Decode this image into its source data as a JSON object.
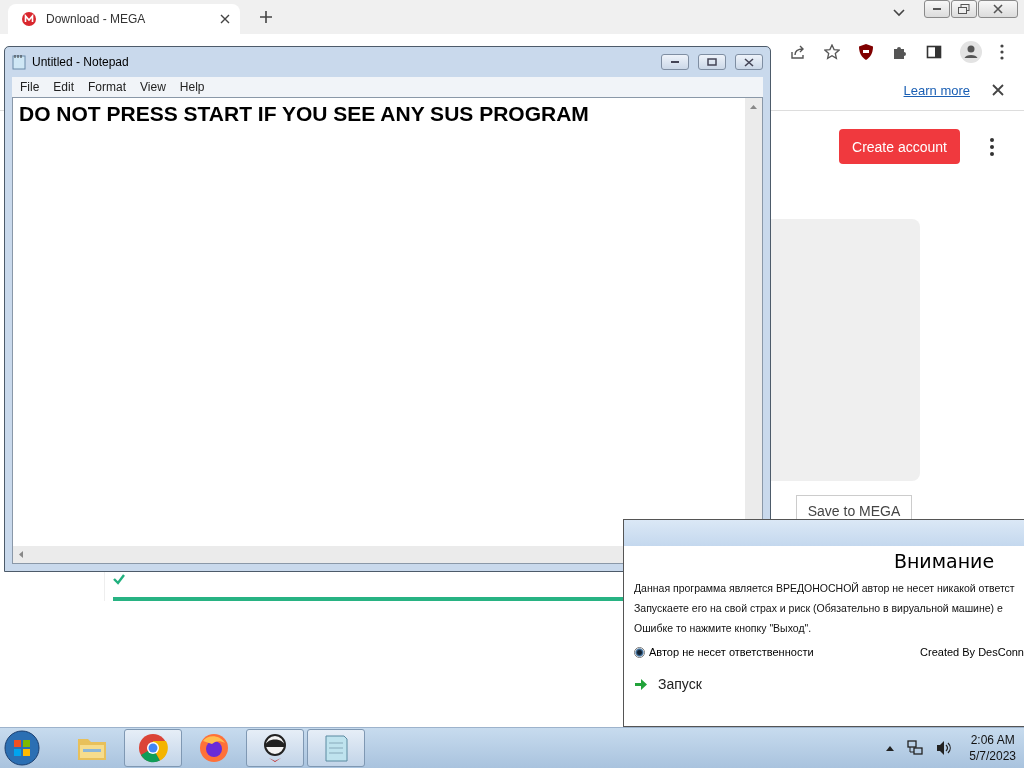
{
  "browser": {
    "tab": {
      "title": "Download - MEGA"
    },
    "info_bar": {
      "link": "Learn more"
    },
    "page": {
      "create_account": "Create account",
      "save_button": "Save to MEGA",
      "progress": {
        "level": 1
      }
    }
  },
  "notepad": {
    "title": "Untitled - Notepad",
    "menu": [
      "File",
      "Edit",
      "Format",
      "View",
      "Help"
    ],
    "content": "DO NOT PRESS START IF YOU SEE ANY SUS PROGRAM"
  },
  "dialog": {
    "heading": "Внимание",
    "lines": [
      "Данная программа является ВРЕДОНОСНОЙ автор не несет никакой ответст",
      "Запускаете его на свой страх и риск (Обязательно в вируальной машине) е",
      "Ошибке то нажмите кнопку \"Выход\"."
    ],
    "radio": {
      "label": "Автор не несет ответственности",
      "selected": true
    },
    "credit": "Created By DesConn",
    "start_button": "Запуск"
  },
  "taskbar": {
    "apps": [
      {
        "kind": "explorer",
        "running": false
      },
      {
        "kind": "chrome",
        "running": true
      },
      {
        "kind": "firefox",
        "running": false
      },
      {
        "kind": "app",
        "running": true
      },
      {
        "kind": "notepad",
        "running": true
      }
    ],
    "time": "2:06 AM",
    "date": "5/7/2023"
  }
}
